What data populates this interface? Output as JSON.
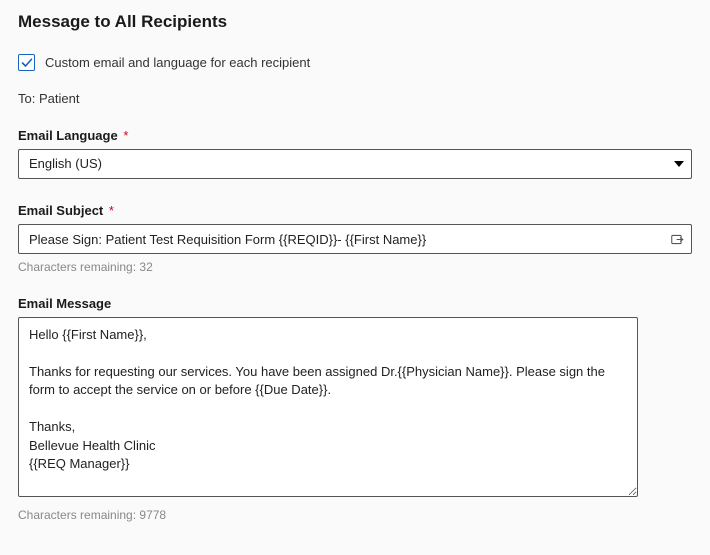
{
  "header": {
    "title": "Message to All Recipients"
  },
  "custom_checkbox": {
    "checked": true,
    "label": "Custom email and language for each recipient"
  },
  "to_line": {
    "prefix": "To:",
    "value": "Patient"
  },
  "language": {
    "label": "Email Language",
    "required": "*",
    "selected": "English (US)"
  },
  "subject": {
    "label": "Email Subject",
    "required": "*",
    "value": "Please Sign: Patient Test Requisition Form {{REQID}}- {{First Name}}",
    "hint_prefix": "Characters remaining:",
    "hint_value": "32"
  },
  "message": {
    "label": "Email Message",
    "value": "Hello {{First Name}},\n\nThanks for requesting our services. You have been assigned Dr.{{Physician Name}}. Please sign the form to accept the service on or before {{Due Date}}.\n\nThanks,\nBellevue Health Clinic\n{{REQ Manager}}",
    "hint_prefix": "Characters remaining:",
    "hint_value": "9778"
  }
}
